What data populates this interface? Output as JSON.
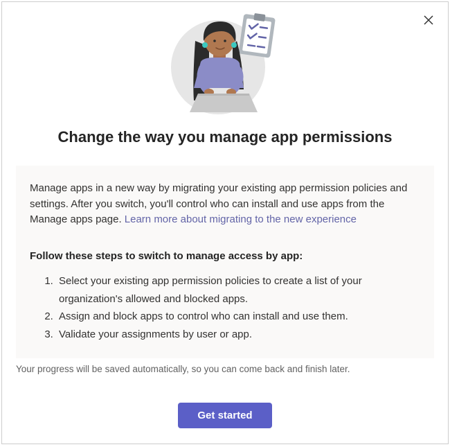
{
  "dialog": {
    "title": "Change the way you manage app permissions",
    "intro_part1": "Manage apps in a new way by migrating your existing app permission policies and settings. After you switch, you'll control who can install and use apps from the Manage apps page. ",
    "learn_link_text": "Learn more about migrating to the new experience",
    "steps_heading": "Follow these steps to switch to manage access by app:",
    "steps": [
      "Select your existing app permission policies to create a list of your organization's allowed and blocked apps.",
      "Assign and block apps to control who can install and use them.",
      "Validate your assignments by user or app."
    ],
    "progress_note": "Your progress will be saved automatically, so you can come back and finish later.",
    "primary_button": "Get started"
  }
}
